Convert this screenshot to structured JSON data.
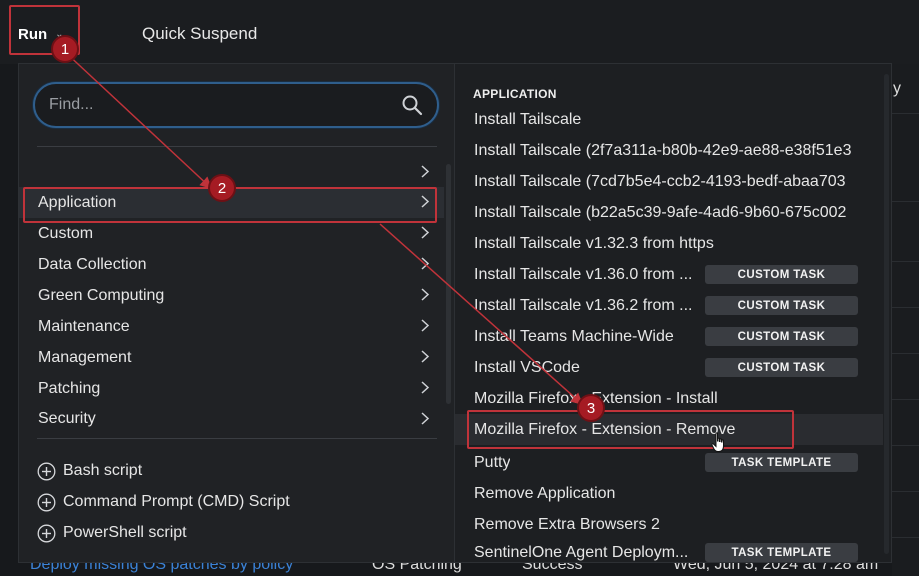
{
  "topbar": {
    "run_label": "Run",
    "quick_suspend_label": "Quick Suspend"
  },
  "search": {
    "placeholder": "Find..."
  },
  "categories": [
    {
      "label": ""
    },
    {
      "label": "Application"
    },
    {
      "label": "Custom"
    },
    {
      "label": "Data Collection"
    },
    {
      "label": "Green Computing"
    },
    {
      "label": "Maintenance"
    },
    {
      "label": "Management"
    },
    {
      "label": "Patching"
    },
    {
      "label": "Security"
    }
  ],
  "scripts": [
    {
      "label": "Bash script"
    },
    {
      "label": "Command Prompt (CMD) Script"
    },
    {
      "label": "PowerShell script"
    }
  ],
  "right_panel": {
    "section_title": "APPLICATION",
    "items": [
      {
        "label": "Install Tailscale",
        "tag": ""
      },
      {
        "label": "Install Tailscale (2f7a311a-b80b-42e9-ae88-e38f51e3",
        "tag": ""
      },
      {
        "label": "Install Tailscale (7cd7b5e4-ccb2-4193-bedf-abaa703",
        "tag": ""
      },
      {
        "label": "Install Tailscale (b22a5c39-9afe-4ad6-9b60-675c002",
        "tag": ""
      },
      {
        "label": "Install Tailscale v1.32.3 from https",
        "tag": ""
      },
      {
        "label": "Install Tailscale v1.36.0 from ...",
        "tag": "CUSTOM TASK"
      },
      {
        "label": "Install Tailscale v1.36.2 from ...",
        "tag": "CUSTOM TASK"
      },
      {
        "label": "Install Teams Machine-Wide",
        "tag": "CUSTOM TASK"
      },
      {
        "label": "Install VSCode",
        "tag": "CUSTOM TASK"
      },
      {
        "label": "Mozilla Firefox - Extension - Install",
        "tag": ""
      },
      {
        "label": "Mozilla Firefox - Extension - Remove",
        "tag": ""
      },
      {
        "label": "Putty",
        "tag": "TASK TEMPLATE"
      },
      {
        "label": "Remove Application",
        "tag": ""
      },
      {
        "label": "Remove Extra Browsers 2",
        "tag": ""
      },
      {
        "label": "SentinelOne Agent Deploym...",
        "tag": "TASK TEMPLATE"
      }
    ]
  },
  "background": {
    "right_edge_text": "y",
    "bottom_row": {
      "name": "Deploy missing OS patches by policy",
      "type": "OS Patching",
      "status": "Success",
      "date": "Wed, Jun 5, 2024 at 7:28 am"
    }
  },
  "annotations": {
    "badges": [
      "1",
      "2",
      "3"
    ],
    "accent_color": "#c0333a"
  },
  "colors": {
    "background": "#17191c",
    "menu": "#202225",
    "search_border": "#2f5e8c",
    "link": "#3b82d6"
  }
}
